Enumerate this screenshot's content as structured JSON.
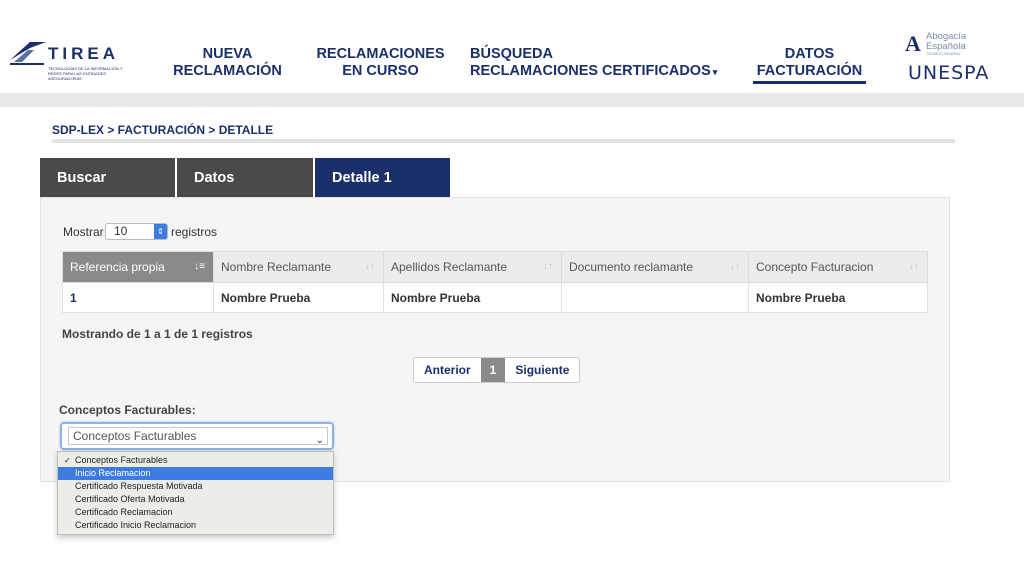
{
  "header": {
    "brand_left": {
      "word": "TIREA",
      "tagline": "TECNOLOGÍAS DE LA INFORMACIÓN Y REDES PARA LAS ENTIDADES ASEGURADORAS"
    },
    "nav": [
      {
        "line1": "NUEVA",
        "line2": "RECLAMACIÓN"
      },
      {
        "line1": "RECLAMACIONES",
        "line2": "EN CURSO"
      },
      {
        "line1": "BÚSQUEDA",
        "line2": "RECLAMACIONES"
      },
      {
        "line1": "CERTIFICADOS",
        "line2": ""
      },
      {
        "line1": "DATOS",
        "line2": "FACTURACIÓN"
      }
    ],
    "brand_right": {
      "abogacia_line1": "Abogacía",
      "abogacia_line2": "Española",
      "abogacia_small": "CONSEJO GENERAL",
      "unespa": "UNESPA"
    }
  },
  "breadcrumb": "SDP-LEX > FACTURACIÓN > DETALLE",
  "tabs": [
    {
      "label": "Buscar"
    },
    {
      "label": "Datos"
    },
    {
      "label": "Detalle 1"
    }
  ],
  "table_controls": {
    "show_label": "Mostrar",
    "page_size": "10",
    "records_label": "registros"
  },
  "table": {
    "columns": [
      "Referencia propia",
      "Nombre Reclamante",
      "Apellidos Reclamante",
      "Documento reclamante",
      "Concepto Facturacion"
    ],
    "rows": [
      [
        "1",
        "Nombre Prueba",
        "Nombre Prueba",
        "",
        "Nombre Prueba"
      ]
    ]
  },
  "info_text": "Mostrando de 1 a 1 de 1 registros",
  "pagination": {
    "prev": "Anterior",
    "current": "1",
    "next": "Siguiente"
  },
  "conceptos": {
    "label": "Conceptos Facturables:",
    "selected": "Conceptos Facturables",
    "options": [
      "Conceptos Facturables",
      "Inicio Reclamacion",
      "Certificado Respuesta Motivada",
      "Certificado Oferta Motivada",
      "Certificado Reclamacion",
      "Certificado Inicio Reclamacion"
    ],
    "highlighted_index": 1
  },
  "colors": {
    "navy": "#1b2f6b",
    "tab_grey": "#4a4a4a",
    "highlight": "#3e7be0"
  }
}
